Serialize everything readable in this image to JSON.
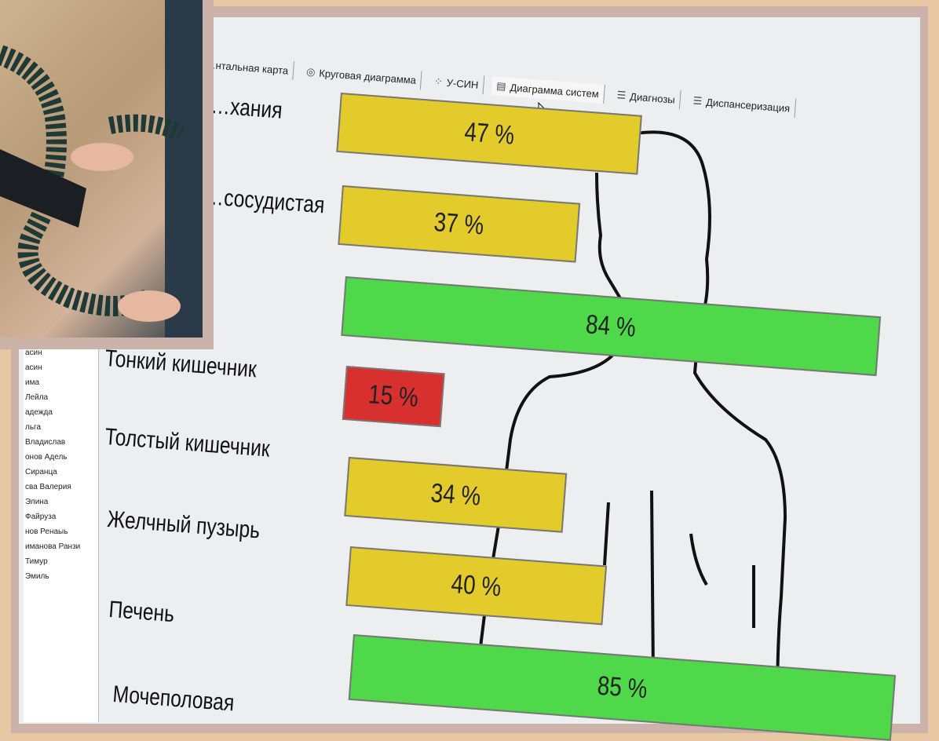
{
  "tabs": [
    {
      "label": "…нтальная карта",
      "icon": "table-icon",
      "active": false
    },
    {
      "label": "Круговая диаграмма",
      "icon": "pie-chart-icon",
      "active": false
    },
    {
      "label": "У-СИН",
      "icon": "dots-icon",
      "active": false
    },
    {
      "label": "Диаграмма систем",
      "icon": "bar-chart-icon",
      "active": true
    },
    {
      "label": "Диагнозы",
      "icon": "list-icon",
      "active": false
    },
    {
      "label": "Диспансеризация",
      "icon": "list-icon",
      "active": false
    }
  ],
  "patients": [
    "асин",
    "асин",
    "има",
    "Лейла",
    "адежда",
    "льга",
    "Владислав",
    "онов Адель",
    "Сиранца",
    "сва Валерия",
    "Элина",
    "Файруза",
    "нов Ренаыь",
    "иманова Ранзи",
    "Тимур",
    "Эмиль"
  ],
  "organs": [
    {
      "name": "…хания",
      "percent": "47 %",
      "value": 47,
      "status": "warning"
    },
    {
      "name": "…сосудистая",
      "percent": "37 %",
      "value": 37,
      "status": "warning"
    },
    {
      "name": "",
      "percent": "84 %",
      "value": 84,
      "status": "normal"
    },
    {
      "name": "Тонкий кишечник",
      "percent": "15 %",
      "value": 15,
      "status": "critical"
    },
    {
      "name": "Толстый кишечник",
      "percent": "34 %",
      "value": 34,
      "status": "warning"
    },
    {
      "name": "Желчный пузырь",
      "percent": "40 %",
      "value": 40,
      "status": "warning"
    },
    {
      "name": "Печень",
      "percent": "",
      "value": null,
      "status": "none"
    },
    {
      "name": "Мочеполовая",
      "percent": "85 %",
      "value": 85,
      "status": "normal"
    }
  ],
  "colors": {
    "warning": "#e3cb2c",
    "normal": "#4ed84a",
    "critical": "#d8302e"
  }
}
